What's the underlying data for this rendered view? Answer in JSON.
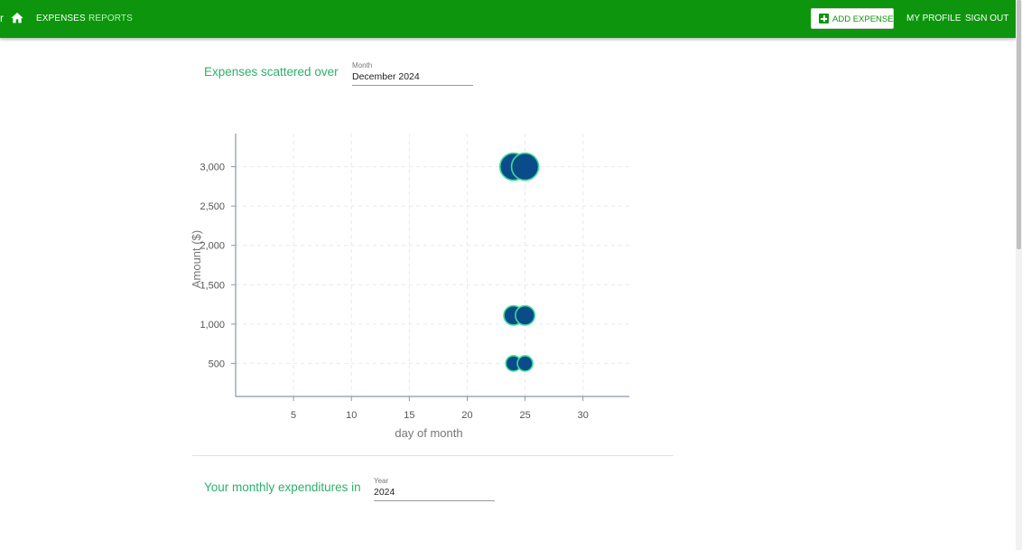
{
  "nav": {
    "edge_glyph": "r",
    "expenses": "EXPENSES",
    "reports": "REPORTS",
    "add_expense": "ADD EXPENSE",
    "my_profile": "MY PROFILE",
    "sign_out": "SIGN OUT",
    "icons": [
      "home-icon",
      "add-box-icon"
    ]
  },
  "colors": {
    "topbar": "#0d960d",
    "title_accent": "#2eb06a",
    "point_fill": "#0a4b8a",
    "point_stroke": "#3ddc97"
  },
  "scatter_section": {
    "title": "Expenses scattered over",
    "month_label": "Month",
    "month_value": "December 2024"
  },
  "monthly_section": {
    "title": "Your monthly expenditures in",
    "year_label": "Year",
    "year_value": "2024"
  },
  "chart_data": {
    "type": "scatter",
    "title": "",
    "xlabel": "day of month",
    "ylabel": "Amount ($)",
    "xlim": [
      0,
      34
    ],
    "ylim": [
      80,
      3420
    ],
    "xticks": [
      5,
      10,
      15,
      20,
      25,
      30
    ],
    "xtick_labels": [
      "5",
      "10",
      "15",
      "20",
      "25",
      "30"
    ],
    "yticks": [
      500,
      1000,
      1500,
      2000,
      2500,
      3000
    ],
    "ytick_labels": [
      "500",
      "1,000",
      "1,500",
      "2,000",
      "2,500",
      "3,000"
    ],
    "grid": true,
    "bubble_size_encodes": "amount",
    "points": [
      {
        "x": 24,
        "y": 3000,
        "size": 3000
      },
      {
        "x": 25,
        "y": 3000,
        "size": 3000
      },
      {
        "x": 24,
        "y": 1110,
        "size": 1110
      },
      {
        "x": 25,
        "y": 1110,
        "size": 1110
      },
      {
        "x": 24,
        "y": 500,
        "size": 500
      },
      {
        "x": 25,
        "y": 500,
        "size": 500
      }
    ]
  }
}
